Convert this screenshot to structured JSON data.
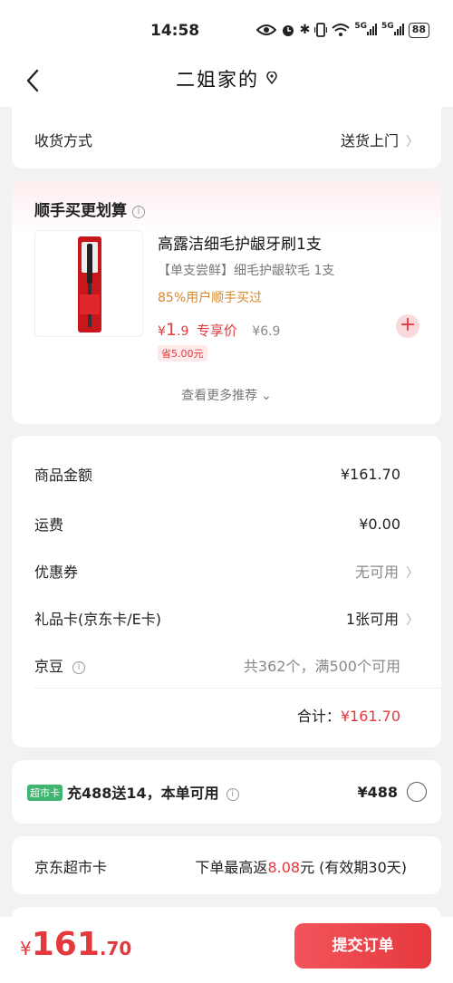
{
  "status": {
    "time": "14:58",
    "net1": "5G",
    "net2": "5G",
    "battery": "88"
  },
  "header": {
    "title": "二姐家的"
  },
  "delivery": {
    "label": "收货方式",
    "value": "送货上门"
  },
  "combo": {
    "title": "顺手买更划算",
    "product": {
      "name": "高露洁细毛护龈牙刷1支",
      "subtitle": "【单支尝鲜】细毛护龈软毛 1支",
      "buy_rate": "85%用户顺手买过",
      "price_symbol": "¥",
      "price_int": "1",
      "price_dec": ".9",
      "price_tag": "专享价",
      "old_price": "¥6.9",
      "save": "省5.00元"
    },
    "more": "查看更多推荐"
  },
  "summary": {
    "rows": [
      {
        "label": "商品金额",
        "value": "¥161.70"
      },
      {
        "label": "运费",
        "value": "¥0.00"
      },
      {
        "label": "优惠券",
        "value": "无可用"
      },
      {
        "label": "礼品卡(京东卡/E卡)",
        "value": "1张可用"
      },
      {
        "label": "京豆",
        "value": "共362个，满500个可用"
      }
    ],
    "total_label": "合计：",
    "total_value": "¥161.70"
  },
  "card_offer": {
    "badge": "超市卡",
    "text": "充488送14，本单可用",
    "price": "¥488"
  },
  "supermarket": {
    "label": "京东超市卡",
    "text_prefix": "下单最高返",
    "amount": "8.08",
    "text_suffix": "元 (有效期30天)"
  },
  "bottom": {
    "currency": "¥",
    "total_int": "161",
    "total_dec": ".70",
    "submit_label": "提交订单"
  },
  "colors": {
    "accent": "#e4393c",
    "badge_green": "#3fb56f",
    "orange": "#d4872f"
  }
}
